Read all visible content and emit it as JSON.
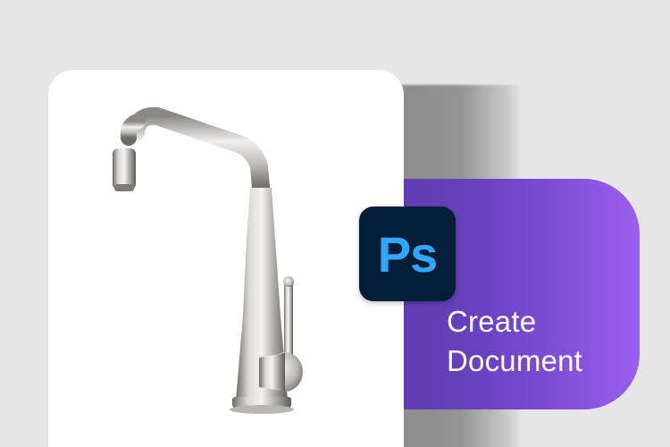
{
  "product": {
    "image_name": "kitchen-faucet",
    "image_desc": "brushed nickel kitchen faucet"
  },
  "app_badge": {
    "text": "Ps",
    "icon": "photoshop-icon",
    "bg_color": "#001e36",
    "text_color": "#31a8ff"
  },
  "action": {
    "line1": "Create",
    "line2": "Document",
    "gradient_start": "#5e3db0",
    "gradient_end": "#9b5ef0"
  },
  "colors": {
    "background": "#e6e6e6",
    "card": "#ffffff"
  }
}
